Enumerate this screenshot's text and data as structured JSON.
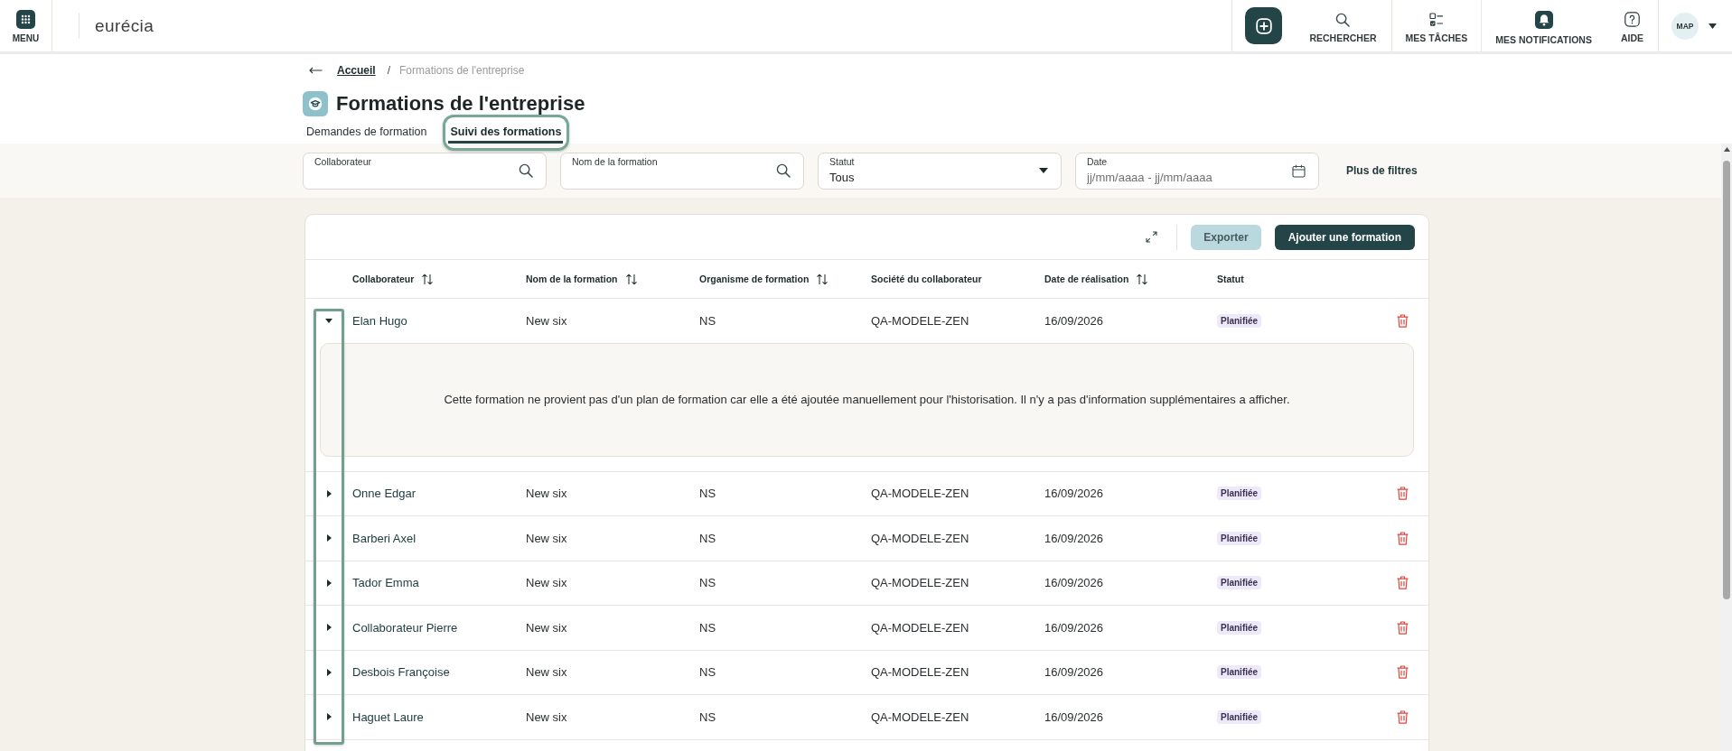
{
  "top_bar": {
    "menu_label": "MENU",
    "logo": "eurécia",
    "actions": [
      {
        "kind": "add"
      },
      {
        "kind": "search",
        "label": "RECHERCHER"
      },
      {
        "kind": "tasks",
        "label": "MES TÂCHES"
      },
      {
        "kind": "notifications",
        "label": "MES NOTIFICATIONS"
      },
      {
        "kind": "help",
        "label": "AIDE"
      }
    ],
    "user_initials": "MAP"
  },
  "breadcrumb": {
    "items": [
      {
        "kind": "link",
        "label": "Accueil"
      },
      {
        "kind": "current",
        "label": "Formations de l'entreprise"
      }
    ],
    "separator": "/"
  },
  "page_title": "Formations de l'entreprise",
  "tabs": [
    {
      "label": "Demandes de formation",
      "selected": false,
      "highlighted": false
    },
    {
      "label": "Suivi des formations",
      "selected": true,
      "highlighted": true
    }
  ],
  "filters": {
    "fields": [
      {
        "kind": "search",
        "label": "Collaborateur"
      },
      {
        "kind": "search",
        "label": "Nom de la formation"
      },
      {
        "kind": "select",
        "label": "Statut",
        "value": "Tous"
      },
      {
        "kind": "date",
        "label": "Date",
        "placeholder": "jj/mm/aaaa - jj/mm/aaaa"
      }
    ],
    "more_filters": "Plus de filtres"
  },
  "table": {
    "actions": [
      {
        "kind": "secondary",
        "label": "Exporter"
      },
      {
        "kind": "primary",
        "label": "Ajouter une formation"
      }
    ],
    "columns": [
      {
        "label": "Collaborateur",
        "sortable": true
      },
      {
        "label": "Nom de la formation",
        "sortable": true
      },
      {
        "label": "Organisme de formation",
        "sortable": true
      },
      {
        "label": "Société du collaborateur",
        "sortable": false
      },
      {
        "label": "Date de réalisation",
        "sortable": true
      },
      {
        "label": "Statut",
        "sortable": false
      }
    ],
    "toggle_column_highlighted": true,
    "rows": [
      {
        "cells": [
          "Elan Hugo",
          "New six",
          "NS",
          "QA-MODELE-ZEN",
          "16/09/2026"
        ],
        "status": "Planifiée",
        "expanded": true,
        "detail": "Cette formation ne provient pas d'un plan de formation car elle a été ajoutée manuellement pour l'historisation. Il n'y a pas d'information supplémentaires a afficher."
      },
      {
        "cells": [
          "Onne Edgar",
          "New six",
          "NS",
          "QA-MODELE-ZEN",
          "16/09/2026"
        ],
        "status": "Planifiée",
        "expanded": false
      },
      {
        "cells": [
          "Barberi Axel",
          "New six",
          "NS",
          "QA-MODELE-ZEN",
          "16/09/2026"
        ],
        "status": "Planifiée",
        "expanded": false
      },
      {
        "cells": [
          "Tador Emma",
          "New six",
          "NS",
          "QA-MODELE-ZEN",
          "16/09/2026"
        ],
        "status": "Planifiée",
        "expanded": false
      },
      {
        "cells": [
          "Collaborateur Pierre",
          "New six",
          "NS",
          "QA-MODELE-ZEN",
          "16/09/2026"
        ],
        "status": "Planifiée",
        "expanded": false
      },
      {
        "cells": [
          "Desbois Françoise",
          "New six",
          "NS",
          "QA-MODELE-ZEN",
          "16/09/2026"
        ],
        "status": "Planifiée",
        "expanded": false
      },
      {
        "cells": [
          "Haguet Laure",
          "New six",
          "NS",
          "QA-MODELE-ZEN",
          "16/09/2026"
        ],
        "status": "Planifiée",
        "expanded": false
      }
    ]
  }
}
